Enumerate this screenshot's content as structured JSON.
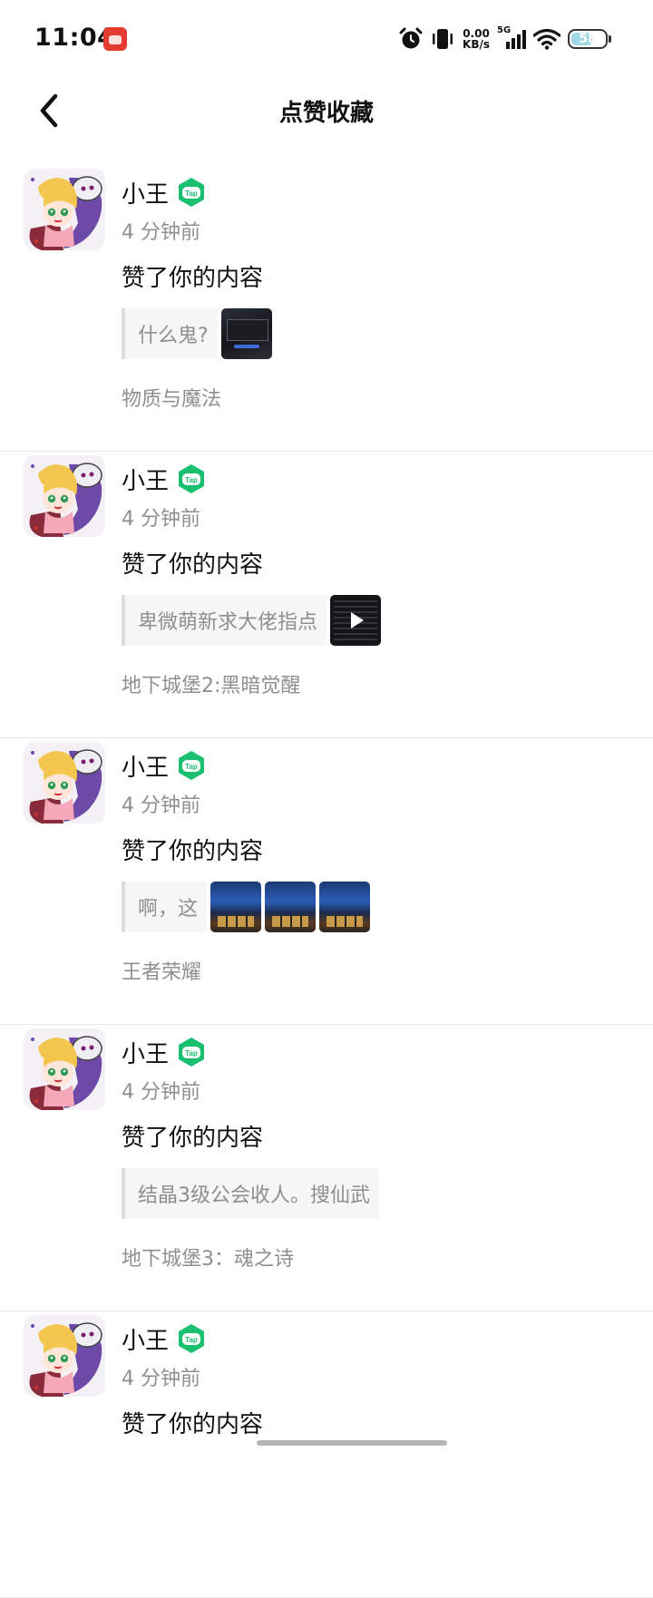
{
  "status_bar": {
    "time": "11:04",
    "app_icon": "notification-app-icon",
    "net_speed_value": "0.00",
    "net_speed_unit": "KB/s",
    "network_type": "5G",
    "battery_level": "58"
  },
  "header": {
    "title": "点赞收藏",
    "back_icon": "chevron-left-icon"
  },
  "items": [
    {
      "name": "小王",
      "time": "4 分钟前",
      "action": "赞了你的内容",
      "quote": "什么鬼?",
      "thumbs": [
        "dark"
      ],
      "game": "物质与魔法"
    },
    {
      "name": "小王",
      "time": "4 分钟前",
      "action": "赞了你的内容",
      "quote": "卑微萌新求大佬指点",
      "thumbs": [
        "video"
      ],
      "game": "地下城堡2:黑暗觉醒"
    },
    {
      "name": "小王",
      "time": "4 分钟前",
      "action": "赞了你的内容",
      "quote": "啊，这",
      "thumbs": [
        "game",
        "game",
        "game"
      ],
      "game": "王者荣耀"
    },
    {
      "name": "小王",
      "time": "4 分钟前",
      "action": "赞了你的内容",
      "quote": "结晶3级公会收人。搜仙武",
      "thumbs": [],
      "game": "地下城堡3：魂之诗"
    },
    {
      "name": "小王",
      "time": "4 分钟前",
      "action": "赞了你的内容",
      "quote": "",
      "thumbs": [],
      "game": ""
    }
  ],
  "badge": {
    "text": "Tap",
    "color": "#19c06f"
  },
  "colors": {
    "secondary_text": "#8f8f8f",
    "quote_bg": "#f6f6f7"
  }
}
